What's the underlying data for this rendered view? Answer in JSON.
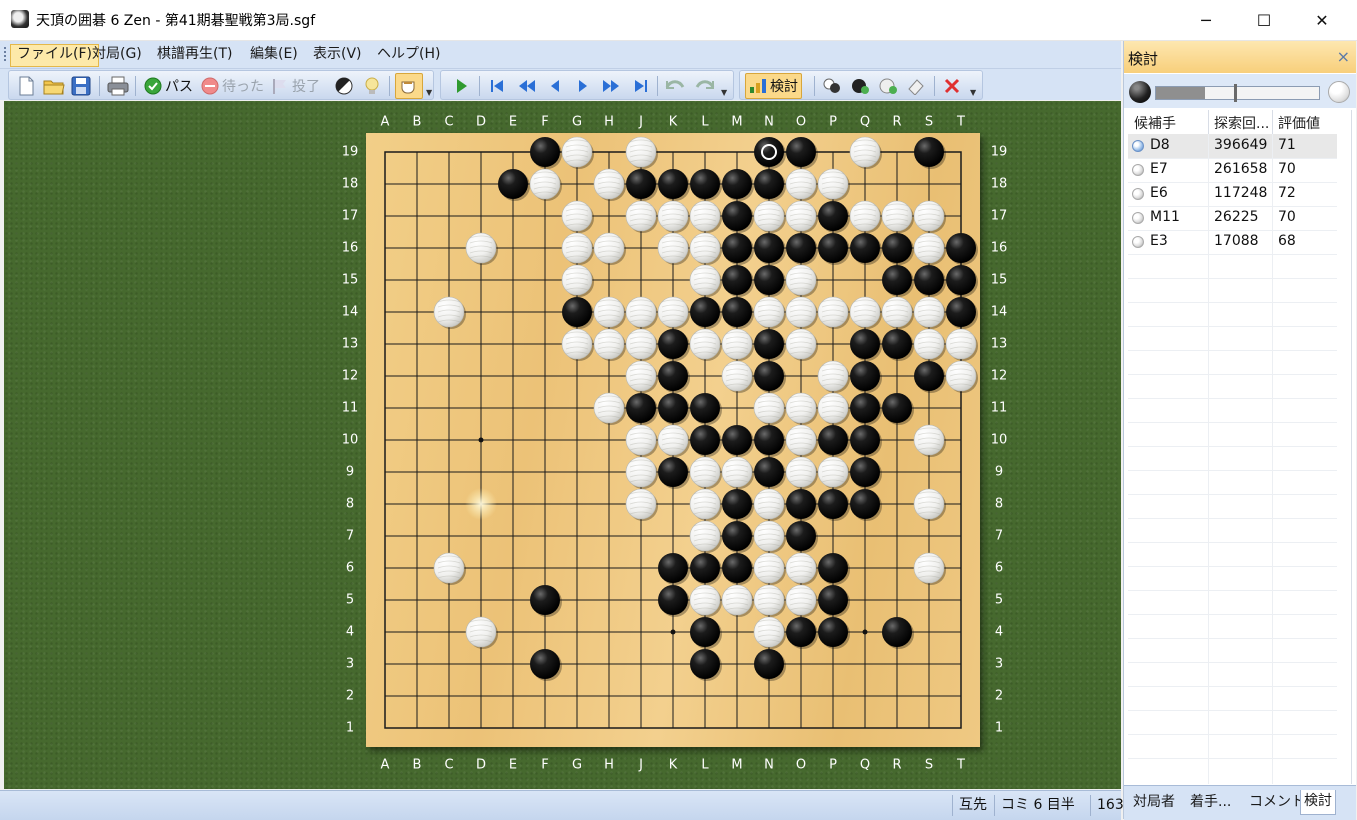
{
  "window": {
    "title": "天頂の囲碁 6 Zen - 第41期碁聖戦第3局.sgf",
    "minimize": "─",
    "maximize": "☐",
    "close": "✕"
  },
  "menu": [
    {
      "label": "ファイル(F)",
      "active": true
    },
    {
      "label": "対局(G)"
    },
    {
      "label": "棋譜再生(T)"
    },
    {
      "label": "編集(E)"
    },
    {
      "label": "表示(V)"
    },
    {
      "label": "ヘルプ(H)"
    }
  ],
  "toolbar": {
    "pass_label": "パス",
    "undo_label": "待った",
    "resign_label": "投了",
    "review_label": "検討"
  },
  "board": {
    "columns": [
      "A",
      "B",
      "C",
      "D",
      "E",
      "F",
      "G",
      "H",
      "J",
      "K",
      "L",
      "M",
      "N",
      "O",
      "P",
      "Q",
      "R",
      "S",
      "T"
    ],
    "rows": [
      "19",
      "18",
      "17",
      "16",
      "15",
      "14",
      "13",
      "12",
      "11",
      "10",
      "9",
      "8",
      "7",
      "6",
      "5",
      "4",
      "3",
      "2",
      "1"
    ],
    "star_points": [
      "D10",
      "K4",
      "Q4"
    ],
    "last_move": "N19",
    "black": [
      "F19",
      "N19",
      "O19",
      "S19",
      "E18",
      "J18",
      "K18",
      "L18",
      "M18",
      "N18",
      "M17",
      "P17",
      "M16",
      "N16",
      "O16",
      "P16",
      "Q16",
      "R16",
      "T16",
      "M15",
      "N15",
      "R15",
      "S15",
      "T15",
      "G14",
      "L14",
      "M14",
      "T14",
      "K13",
      "N13",
      "Q13",
      "R13",
      "K12",
      "N12",
      "Q12",
      "S12",
      "J11",
      "K11",
      "L11",
      "Q11",
      "R11",
      "L10",
      "M10",
      "N10",
      "P10",
      "Q10",
      "K9",
      "N9",
      "Q9",
      "M8",
      "O8",
      "P8",
      "Q8",
      "M7",
      "O7",
      "K6",
      "L6",
      "M6",
      "P6",
      "F5",
      "K5",
      "P5",
      "L4",
      "O4",
      "P4",
      "R4",
      "F3",
      "L3",
      "N3"
    ],
    "white": [
      "G19",
      "J19",
      "Q19",
      "F18",
      "H18",
      "O18",
      "P18",
      "G17",
      "J17",
      "K17",
      "L17",
      "N17",
      "O17",
      "Q17",
      "R17",
      "S17",
      "D16",
      "G16",
      "H16",
      "K16",
      "L16",
      "S16",
      "G15",
      "L15",
      "O15",
      "C14",
      "H14",
      "J14",
      "K14",
      "N14",
      "O14",
      "P14",
      "Q14",
      "R14",
      "S14",
      "G13",
      "H13",
      "J13",
      "L13",
      "M13",
      "O13",
      "S13",
      "T13",
      "J12",
      "M12",
      "P12",
      "T12",
      "H11",
      "N11",
      "O11",
      "P11",
      "J10",
      "K10",
      "O10",
      "S10",
      "J9",
      "L9",
      "M9",
      "O9",
      "P9",
      "J8",
      "L8",
      "N8",
      "S8",
      "L7",
      "N7",
      "C6",
      "N6",
      "O6",
      "S6",
      "L5",
      "M5",
      "N5",
      "O5",
      "D4",
      "N4"
    ],
    "highlight": "D8"
  },
  "status": {
    "cell1": "互先",
    "cell2": "コミ 6 目半",
    "cell3": "163"
  },
  "panel": {
    "title": "検討",
    "close": "×",
    "slider_black_fraction": 0.3,
    "headers": [
      "候補手",
      "探索回...",
      "評価値"
    ],
    "candidates": [
      {
        "move": "D8",
        "visits": "396649",
        "score": "71",
        "selected": true
      },
      {
        "move": "E7",
        "visits": "261658",
        "score": "70"
      },
      {
        "move": "E6",
        "visits": "117248",
        "score": "72"
      },
      {
        "move": "M11",
        "visits": "26225",
        "score": "70"
      },
      {
        "move": "E3",
        "visits": "17088",
        "score": "68"
      }
    ],
    "tabs": [
      {
        "label": "対局者"
      },
      {
        "label": "着手..."
      },
      {
        "label": "コメント"
      },
      {
        "label": "検討",
        "active": true
      }
    ]
  }
}
